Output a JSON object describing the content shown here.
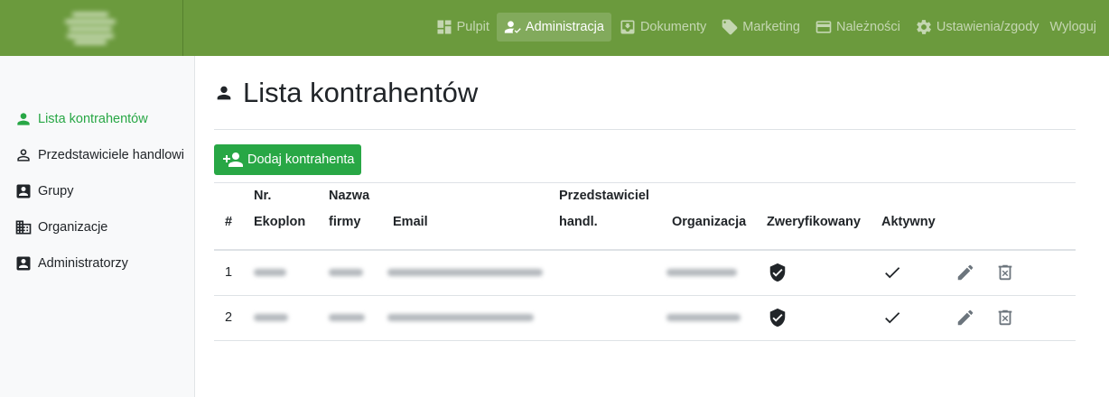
{
  "nav": {
    "items": [
      {
        "label": "Pulpit",
        "icon": "dashboard-icon"
      },
      {
        "label": "Administracja",
        "icon": "user-check-icon"
      },
      {
        "label": "Dokumenty",
        "icon": "inbox-icon"
      },
      {
        "label": "Marketing",
        "icon": "tag-icon"
      },
      {
        "label": "Należności",
        "icon": "credit-card-icon"
      },
      {
        "label": "Ustawienia/zgody",
        "icon": "gear-icon"
      }
    ],
    "logout": "Wyloguj"
  },
  "sidebar": {
    "items": [
      {
        "label": "Lista kontrahentów",
        "icon": "person-icon"
      },
      {
        "label": "Przedstawiciele handlowi",
        "icon": "person-outline-icon"
      },
      {
        "label": "Grupy",
        "icon": "account-box-icon"
      },
      {
        "label": "Organizacje",
        "icon": "building-icon"
      },
      {
        "label": "Administratorzy",
        "icon": "account-box-icon"
      }
    ]
  },
  "page": {
    "title": "Lista kontrahentów",
    "add_button": "Dodaj kontrahenta"
  },
  "table": {
    "headers": {
      "num": "#",
      "ekoplon_1": "Nr.",
      "ekoplon_2": "Ekoplon",
      "firm_1": "Nazwa",
      "firm_2": "firmy",
      "email": "Email",
      "rep_1": "Przedstawiciel",
      "rep_2": "handl.",
      "org": "Organizacja",
      "verified": "Zweryfikowany",
      "active": "Aktywny"
    },
    "rows": [
      {
        "num": "1"
      },
      {
        "num": "2"
      }
    ]
  },
  "colors": {
    "topbar": "#6b9a3d",
    "accent": "#28a745"
  }
}
